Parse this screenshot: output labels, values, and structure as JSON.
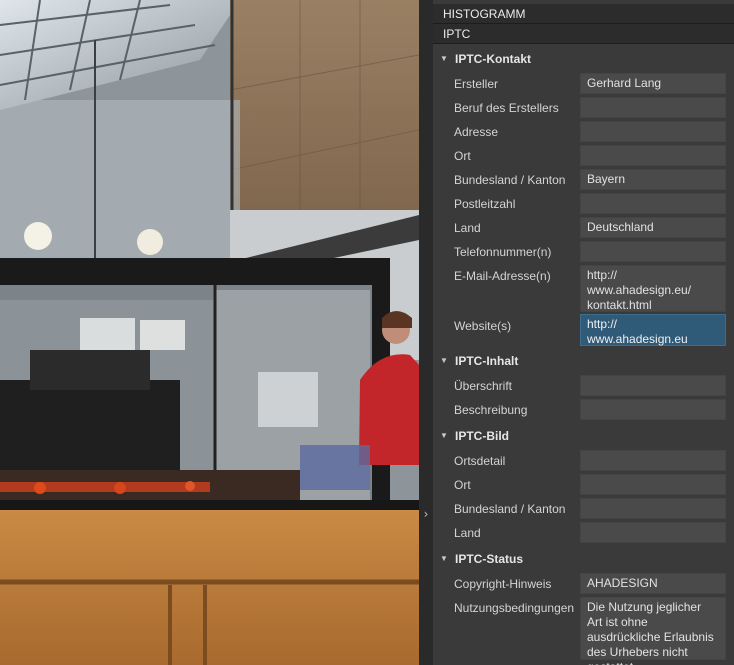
{
  "panel": {
    "histogram_title": "HISTOGRAMM",
    "iptc_title": "IPTC"
  },
  "sections": [
    {
      "title": "IPTC-Kontakt",
      "fields": [
        {
          "label": "Ersteller",
          "value": "Gerhard Lang"
        },
        {
          "label": "Beruf des Erstellers",
          "value": ""
        },
        {
          "label": "Adresse",
          "value": ""
        },
        {
          "label": "Ort",
          "value": ""
        },
        {
          "label": "Bundesland / Kanton",
          "value": "Bayern"
        },
        {
          "label": "Postleitzahl",
          "value": ""
        },
        {
          "label": "Land",
          "value": "Deutschland"
        },
        {
          "label": "Telefonnummer(n)",
          "value": ""
        },
        {
          "label": "E-Mail-Adresse(n)",
          "value": "http://\nwww.ahadesign.eu/\nkontakt.html"
        },
        {
          "label": "Website(s)",
          "value": "http://\nwww.ahadesign.eu",
          "selected": true
        }
      ]
    },
    {
      "title": "IPTC-Inhalt",
      "fields": [
        {
          "label": "Überschrift",
          "value": ""
        },
        {
          "label": "Beschreibung",
          "value": ""
        }
      ]
    },
    {
      "title": "IPTC-Bild",
      "fields": [
        {
          "label": "Ortsdetail",
          "value": ""
        },
        {
          "label": "Ort",
          "value": ""
        },
        {
          "label": "Bundesland / Kanton",
          "value": ""
        },
        {
          "label": "Land",
          "value": ""
        }
      ]
    },
    {
      "title": "IPTC-Status",
      "fields": [
        {
          "label": "Copyright-Hinweis",
          "value": "AHADESIGN"
        },
        {
          "label": "Nutzungsbedingungen",
          "value": "Die Nutzung jeglicher Art ist ohne ausdrückliche Erlaubnis des Urhebers nicht gestattet"
        }
      ]
    }
  ],
  "icons": {
    "section_toggle": "triangle-down-icon",
    "panel_collapse": "chevron-right-icon"
  }
}
